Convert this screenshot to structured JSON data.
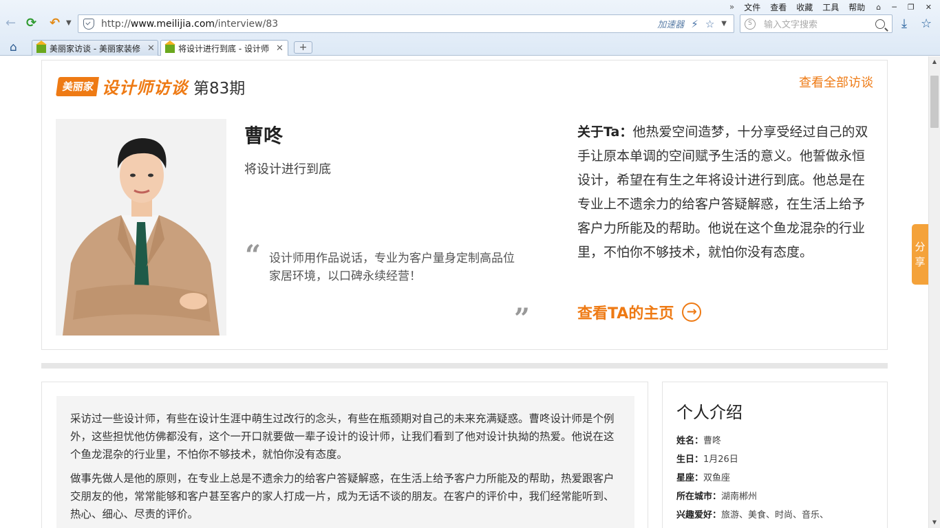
{
  "browser": {
    "menu": [
      "文件",
      "查看",
      "收藏",
      "工具",
      "帮助"
    ],
    "url_prefix": "http://",
    "url_domain": "www.meilijia.com",
    "url_path": "/interview/83",
    "accelerator": "加速器",
    "search_placeholder": "输入文字搜索",
    "tabs": [
      {
        "title": "美丽家访谈 - 美丽家装修",
        "active": false
      },
      {
        "title": "将设计进行到底 - 设计师",
        "active": true
      }
    ],
    "new_tab": "+"
  },
  "hero": {
    "logo_brand": "美丽家",
    "logo_series": "设计师访谈",
    "issue": "第83期",
    "view_all": "查看全部访谈",
    "name": "曹咚",
    "motto": "将设计进行到底",
    "quote": "设计师用作品说话，专业为客户量身定制高品位家居环境，以口碑永续经营！",
    "about_label": "关于Ta：",
    "about_text": "他热爱空间造梦，十分享受经过自己的双手让原本单调的空间赋予生活的意义。他誓做永恒设计，希望在有生之年将设计进行到底。他总是在专业上不遗余力的给客户答疑解惑，在生活上给予客户力所能及的帮助。他说在这个鱼龙混杂的行业里，不怕你不够技术，就怕你没有态度。",
    "homepage_link": "查看TA的主页"
  },
  "article": {
    "paragraphs": [
      "采访过一些设计师，有些在设计生涯中萌生过改行的念头，有些在瓶颈期对自己的未来充满疑惑。曹咚设计师是个例外，这些担忧他仿佛都没有，这个一开口就要做一辈子设计的设计师，让我们看到了他对设计执拗的热爱。他说在这个鱼龙混杂的行业里，不怕你不够技术，就怕你没有态度。",
      "做事先做人是他的原则，在专业上总是不遗余力的给客户答疑解惑，在生活上给予客户力所能及的帮助，热爱跟客户交朋友的他，常常能够和客户甚至客户的家人打成一片，成为无话不谈的朋友。在客户的评价中，我们经常能听到、热心、细心、尽责的评价。"
    ]
  },
  "profile": {
    "title": "个人介绍",
    "items": [
      {
        "label": "姓名：",
        "value": "曹咚"
      },
      {
        "label": "生日：",
        "value": "1月26日"
      },
      {
        "label": "星座：",
        "value": "双鱼座"
      },
      {
        "label": "所在城市：",
        "value": "湖南郴州"
      },
      {
        "label": "兴趣爱好：",
        "value": "旅游、美食、时尚、音乐、"
      }
    ]
  },
  "share": "分享",
  "colors": {
    "accent": "#ee7a14",
    "share": "#f4a23a"
  }
}
